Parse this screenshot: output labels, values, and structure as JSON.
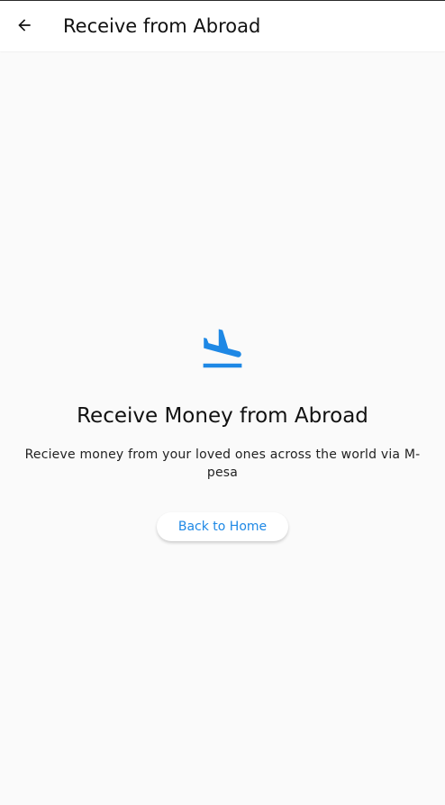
{
  "app_bar": {
    "title": "Receive from Abroad",
    "back_icon": "arrow-left-icon"
  },
  "main": {
    "hero_icon": "flight-land-icon",
    "heading": "Receive Money from Abroad",
    "description": "Recieve money from your loved ones across the world via M-pesa",
    "button_label": "Back to Home"
  },
  "colors": {
    "accent": "#1e88e5",
    "background": "#fafafa",
    "app_bar_background": "#ffffff",
    "text": "#111111"
  }
}
